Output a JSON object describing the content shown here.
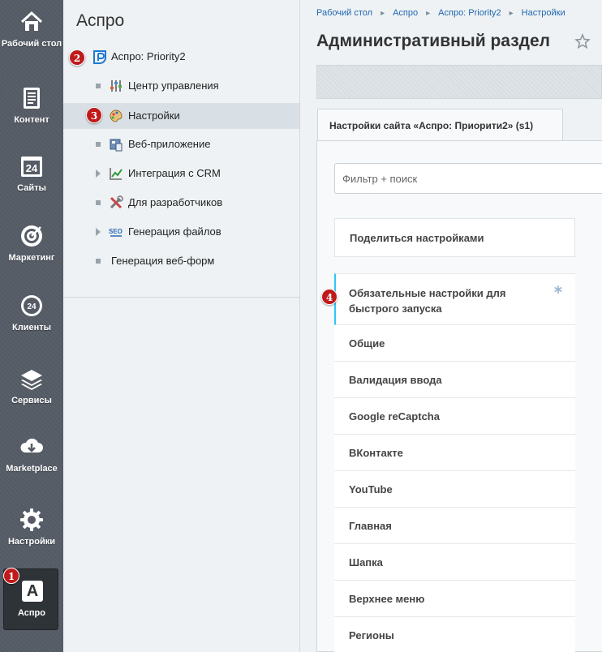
{
  "leftbar": {
    "items": [
      {
        "label": "Рабочий стол",
        "icon": "home-icon"
      },
      {
        "label": "Контент",
        "icon": "document-icon"
      },
      {
        "label": "Сайты",
        "icon": "calendar-24-icon"
      },
      {
        "label": "Маркетинг",
        "icon": "target-icon"
      },
      {
        "label": "Клиенты",
        "icon": "clients-24-icon"
      },
      {
        "label": "Сервисы",
        "icon": "layers-icon"
      },
      {
        "label": "Marketplace",
        "icon": "cloud-download-icon"
      },
      {
        "label": "Настройки",
        "icon": "gear-icon"
      }
    ],
    "active": {
      "label": "Аспро",
      "logo_letter": "A"
    }
  },
  "badges": {
    "b1": "1",
    "b2": "2",
    "b3": "3",
    "b4": "4"
  },
  "menu": {
    "title": "Аспро",
    "root": "Аспро: Priority2",
    "items": [
      {
        "label": "Центр управления"
      },
      {
        "label": "Настройки"
      },
      {
        "label": "Веб-приложение"
      },
      {
        "label": "Интеграция с CRM"
      },
      {
        "label": "Для разработчиков"
      },
      {
        "label": "Генерация файлов"
      },
      {
        "label": "Генерация веб-форм"
      }
    ]
  },
  "main": {
    "breadcrumbs": [
      "Рабочий стол",
      "Аспро",
      "Аспро: Priority2",
      "Настройки"
    ],
    "title": "Административный раздел",
    "tab": "Настройки сайта «Аспро: Приорити2» (s1)",
    "search_placeholder": "Фильтр + поиск",
    "share": "Поделиться настройками",
    "sections": [
      "Обязательные настройки для быстрого запуска",
      "Общие",
      "Валидация ввода",
      "Google reCaptcha",
      "ВКонтакте",
      "YouTube",
      "Главная",
      "Шапка",
      "Верхнее меню",
      "Регионы"
    ]
  },
  "colors": {
    "sidebar": "#555c66",
    "accent": "#2fc6f6",
    "badge": "#c01a1a",
    "link": "#2067b0"
  }
}
